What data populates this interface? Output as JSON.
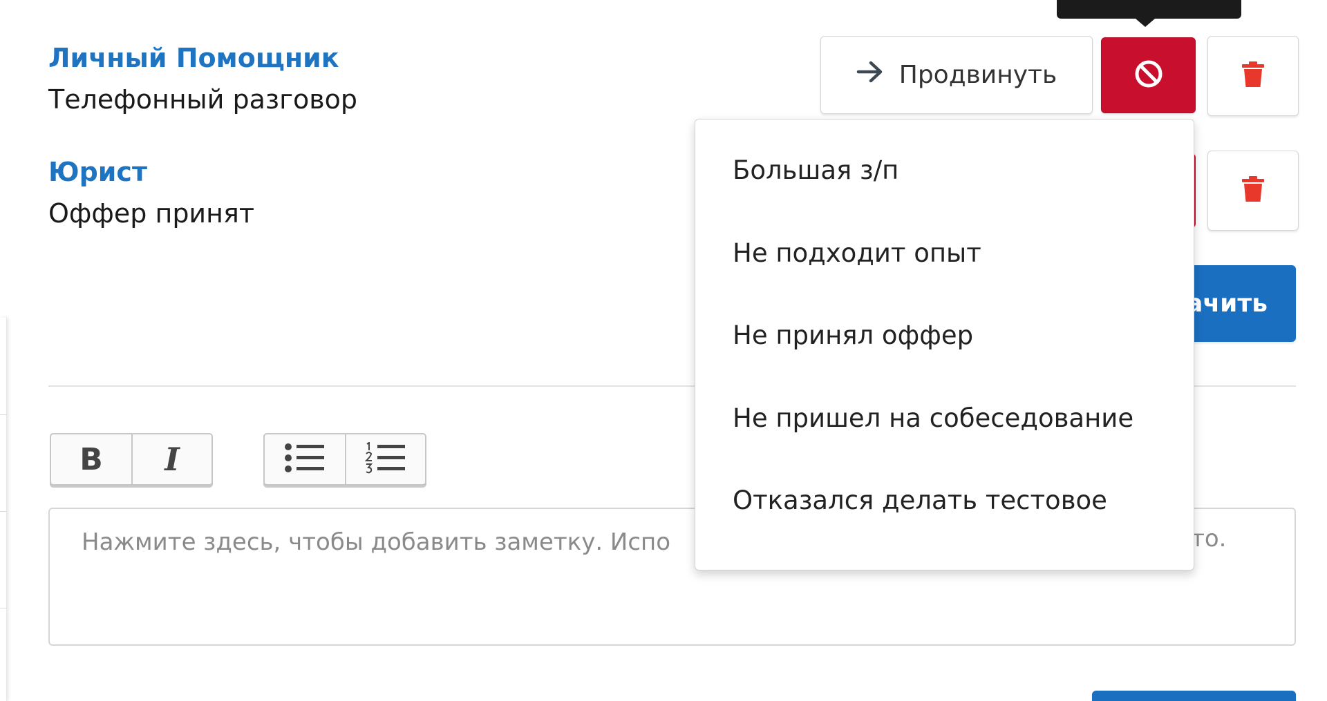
{
  "candidates": [
    {
      "title": "Личный Помощник",
      "status": "Телефонный разговор"
    },
    {
      "title": "Юрист",
      "status": "Оффер принят"
    }
  ],
  "actions": {
    "promote_label": "Продвинуть",
    "assign_label_visible": "ачить"
  },
  "reject_reasons": [
    "Большая з/п",
    "Не подходит опыт",
    "Не принял оффер",
    "Не пришел на собеседование",
    "Отказался делать тестовое"
  ],
  "editor": {
    "bold_label": "B",
    "italic_label": "I",
    "note_placeholder_visible_start": "Нажмите здесь, чтобы добавить заметку. Испо",
    "note_placeholder_visible_end": "о-то."
  },
  "colors": {
    "link_blue": "#1f74c1",
    "reject_red": "#c8102e",
    "delete_red": "#e8372b",
    "primary_blue": "#1a6fc0",
    "tooltip_bg": "#1b1b1b"
  },
  "icons": {
    "promote": "arrow-right-icon",
    "reject": "ban-icon",
    "delete": "trash-icon",
    "bullet_list": "bullet-list-icon",
    "numbered_list": "numbered-list-icon"
  }
}
